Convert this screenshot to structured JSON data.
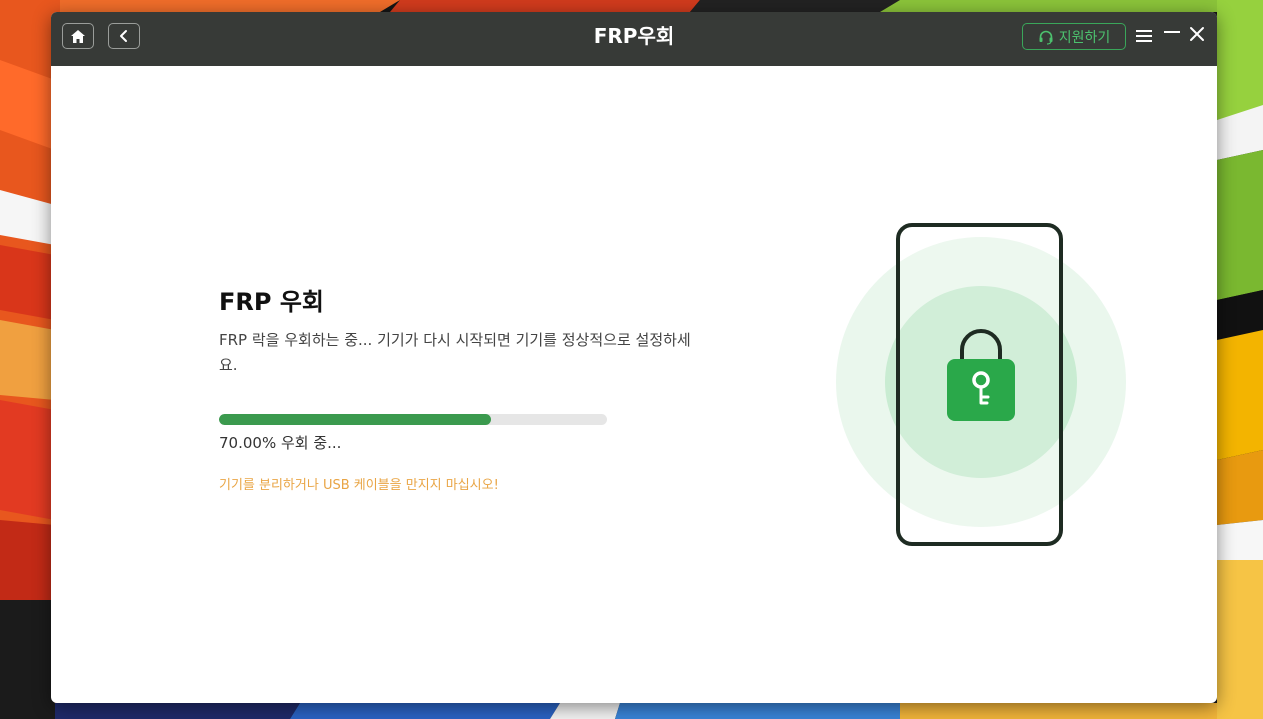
{
  "window": {
    "title": "FRP우회",
    "support_label": "지원하기",
    "icons": [
      "home-icon",
      "back-icon",
      "headset-icon",
      "menu-icon",
      "minimize-icon",
      "close-icon"
    ]
  },
  "content": {
    "heading": "FRP 우회",
    "description": "FRP 락을 우회하는 중... 기기가 다시 시작되면 기기를 정상적으로 설정하세요.",
    "progress_value": 0.7,
    "progress_text": "70.00% 우회 중...",
    "warning": "기기를 분리하거나 USB 케이블을 만지지 마십시오!"
  },
  "colors": {
    "titlebar": "#373a37",
    "accent_green": "#3b9a4e",
    "warning_orange": "#e9a545",
    "lock_green": "#2aa84a"
  }
}
